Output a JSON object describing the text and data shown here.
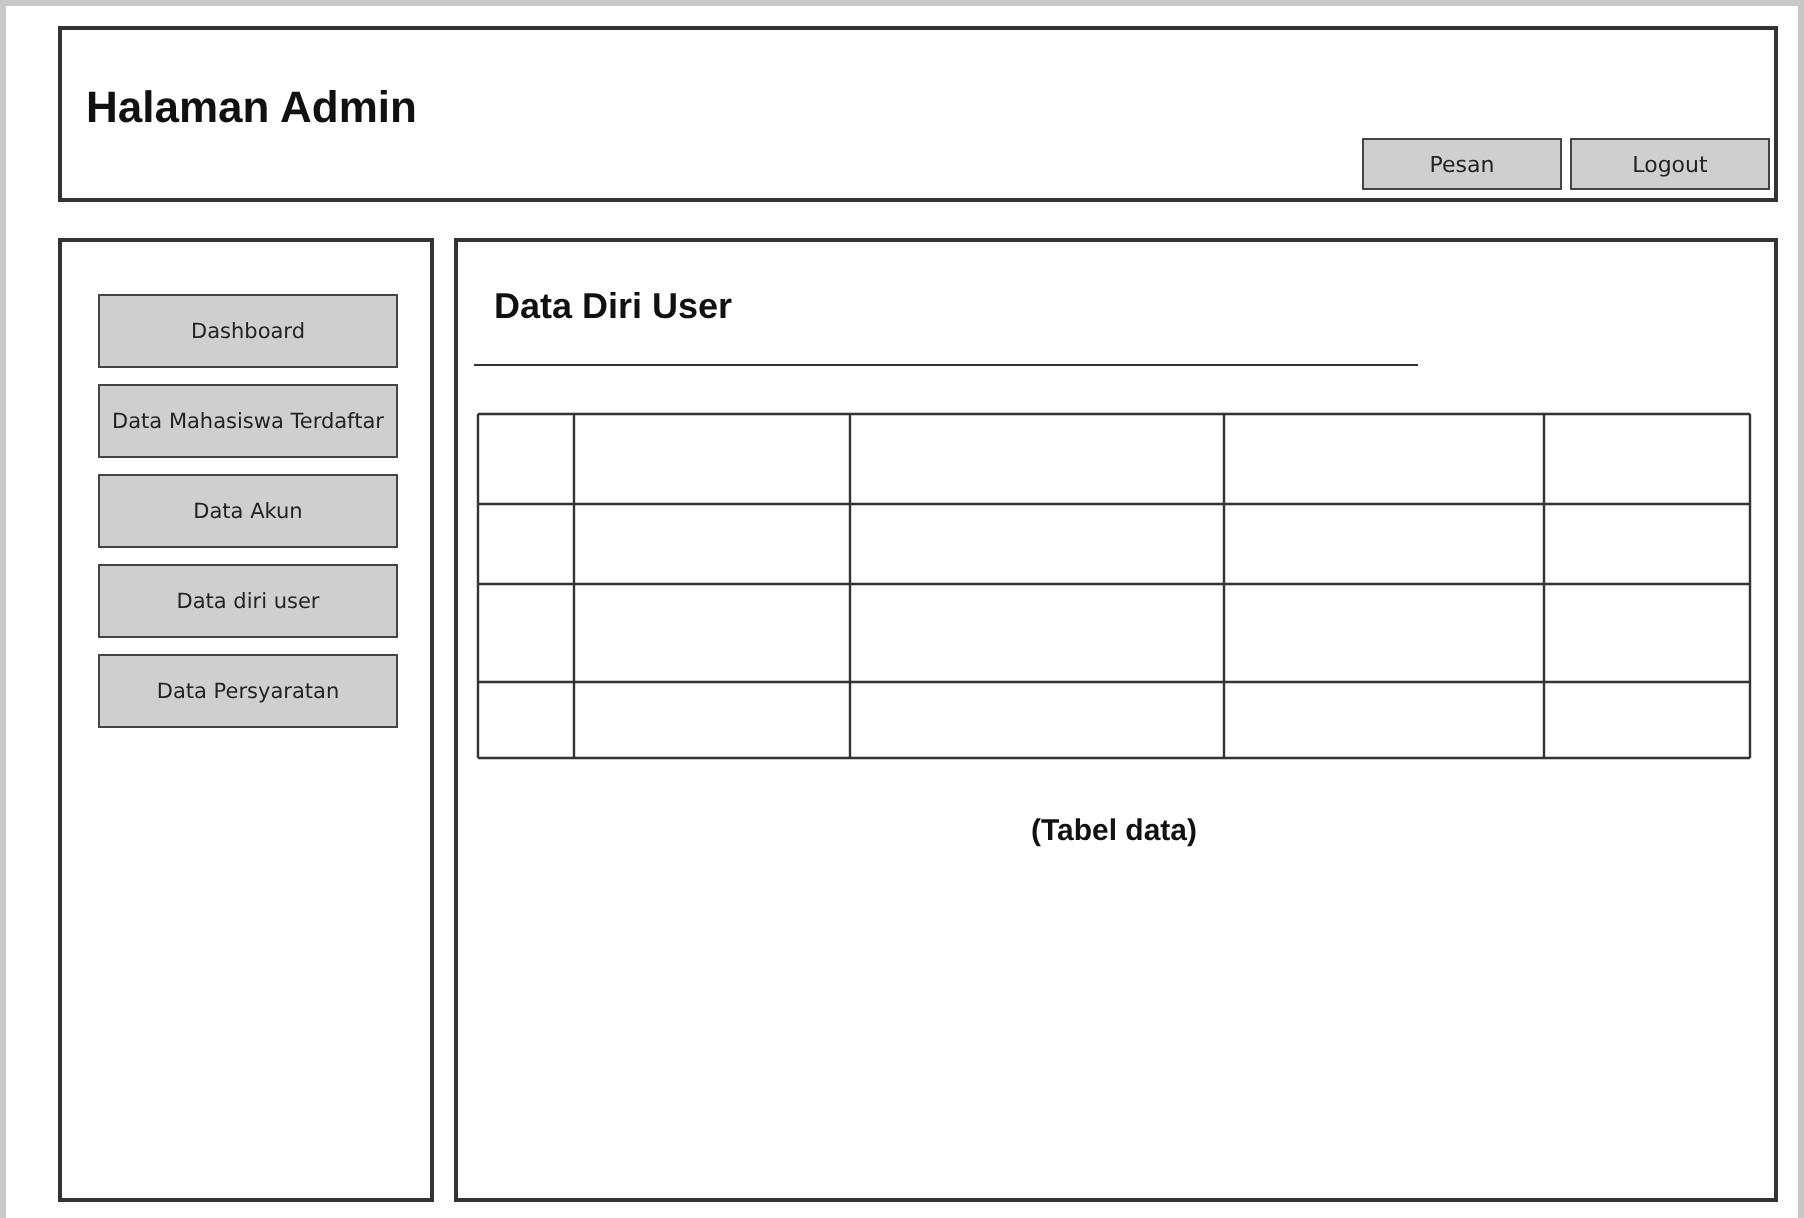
{
  "header": {
    "title": "Halaman Admin",
    "buttons": [
      "Pesan",
      "Logout"
    ]
  },
  "sidebar": {
    "items": [
      "Dashboard",
      "Data Mahasiswa Terdaftar",
      "Data Akun",
      "Data diri user",
      "Data Persyaratan"
    ]
  },
  "main": {
    "title": "Data Diri User",
    "caption": "(Tabel data)"
  }
}
